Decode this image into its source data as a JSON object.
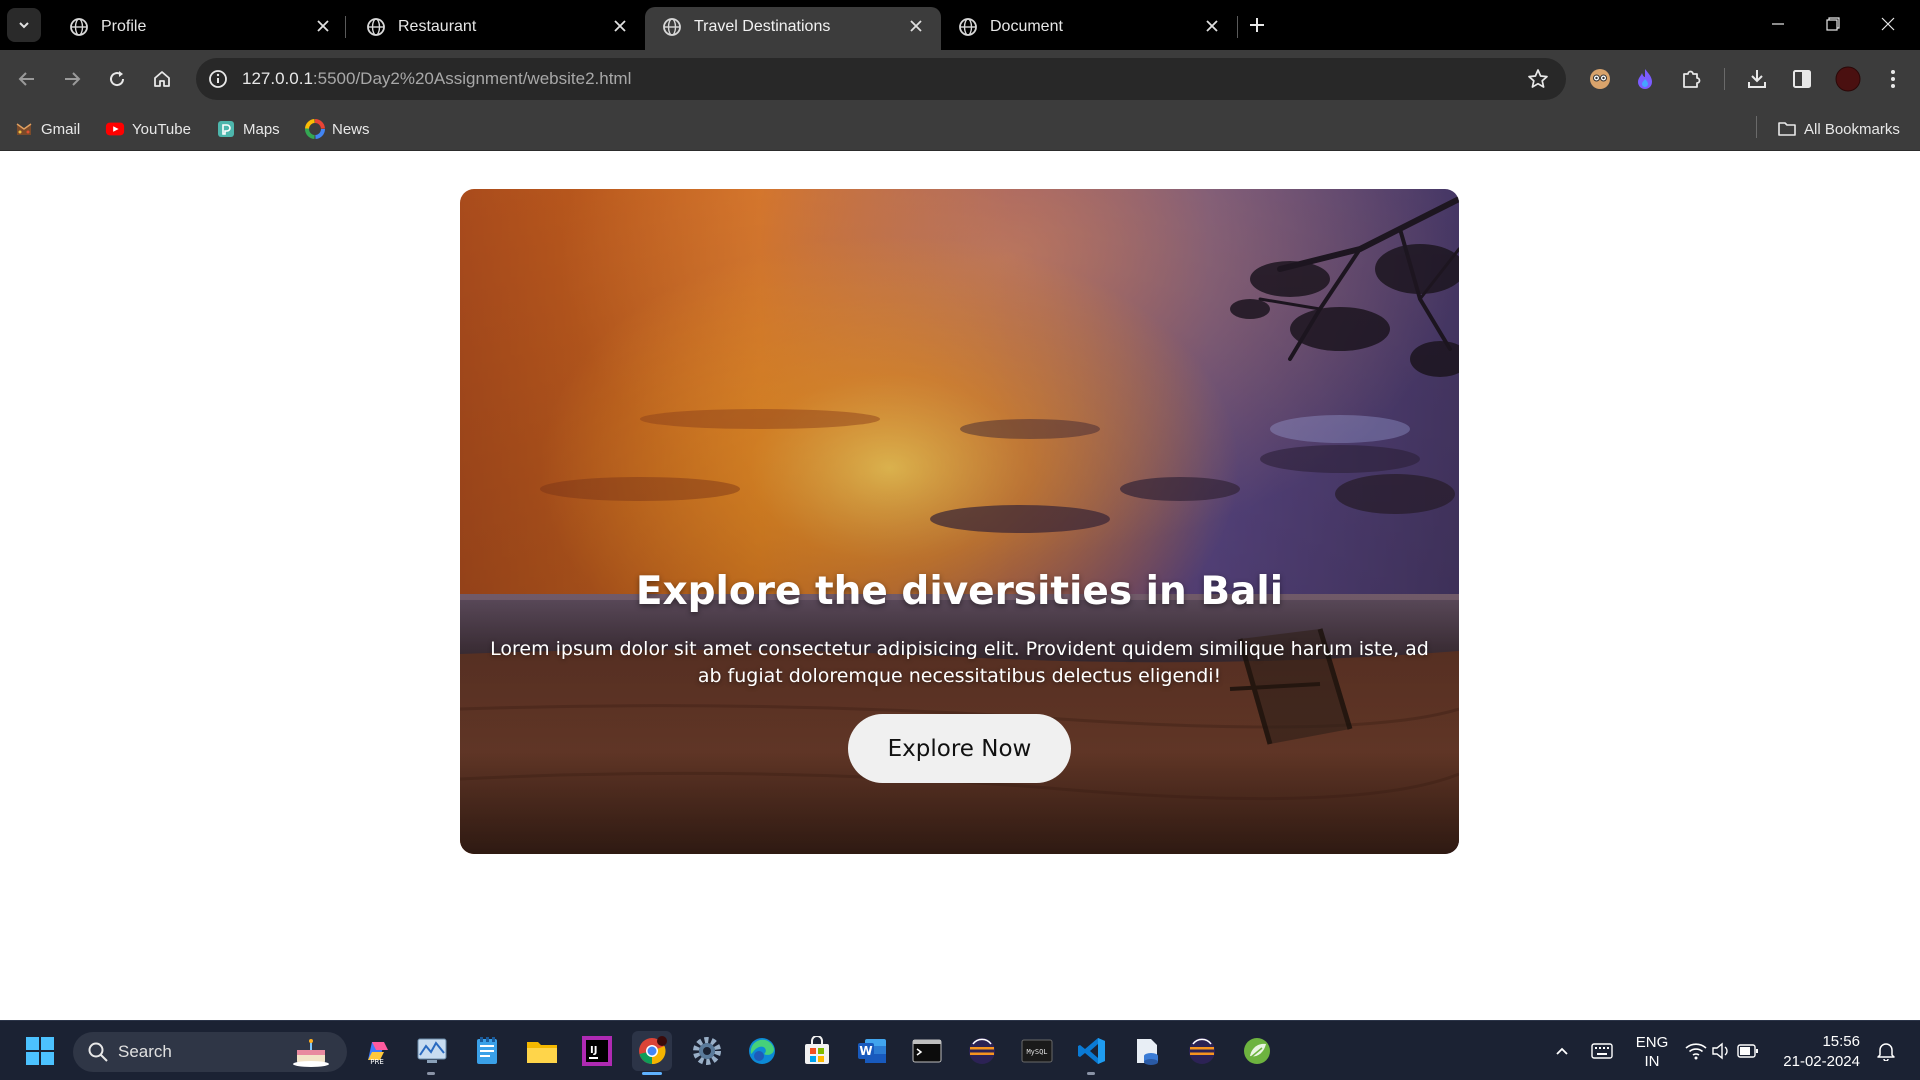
{
  "browser": {
    "tabs": [
      {
        "title": "Profile",
        "active": false
      },
      {
        "title": "Restaurant",
        "active": false
      },
      {
        "title": "Travel Destinations",
        "active": true
      },
      {
        "title": "Document",
        "active": false
      }
    ],
    "url_host": "127.0.0.1",
    "url_rest": ":5500/Day2%20Assignment/website2.html",
    "bookmarks": [
      {
        "label": "Gmail",
        "icon": "gmail-icon"
      },
      {
        "label": "YouTube",
        "icon": "youtube-icon"
      },
      {
        "label": "Maps",
        "icon": "maps-icon"
      },
      {
        "label": "News",
        "icon": "news-icon"
      }
    ],
    "all_bookmarks_label": "All Bookmarks"
  },
  "hero": {
    "title": "Explore the diversities in Bali",
    "text": "Lorem ipsum dolor sit amet consectetur adipisicing elit. Provident quidem similique harum iste, ad ab fugiat doloremque necessitatibus delectus eligendi!",
    "button_label": "Explore Now"
  },
  "taskbar": {
    "search_label": "Search",
    "language_line1": "ENG",
    "language_line2": "IN",
    "time": "15:56",
    "date": "21-02-2024"
  },
  "colors": {
    "titlebar": "#000000",
    "toolbar": "#3c3c3c",
    "omnibox": "#282828",
    "taskbar": "#1b2233",
    "accent": "#5fb2ff"
  }
}
